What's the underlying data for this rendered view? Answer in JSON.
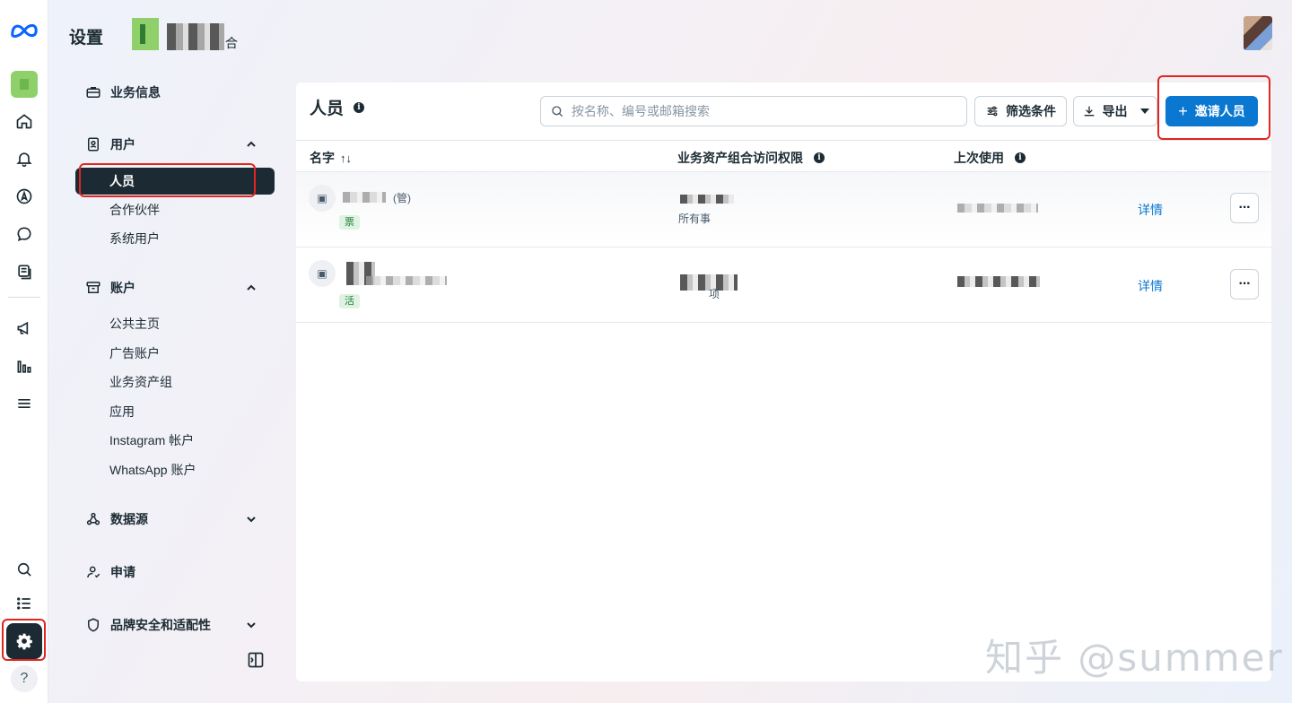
{
  "header": {
    "page_title": "设置",
    "business_name_suffix": "合"
  },
  "nav": {
    "business_info": "业务信息",
    "users": {
      "label": "用户",
      "items": [
        "人员",
        "合作伙伴",
        "系统用户"
      ],
      "active": "人员"
    },
    "accounts": {
      "label": "账户",
      "items": [
        "公共主页",
        "广告账户",
        "业务资产组",
        "应用",
        "Instagram 帐户",
        "WhatsApp 账户"
      ]
    },
    "data_sources": "数据源",
    "requests": "申请",
    "brand_safety": "品牌安全和适配性"
  },
  "panel": {
    "title": "人员",
    "search_placeholder": "按名称、编号或邮箱搜索",
    "filter_label": "筛选条件",
    "export_label": "导出",
    "invite_label": "邀请人员",
    "columns": {
      "name": "名字",
      "sort_glyph": "↑↓",
      "asset_access": "业务资产组合访问权限",
      "last_used": "上次使用"
    },
    "rows": [
      {
        "name_suffix": "(管)",
        "badge": "票",
        "access_text": "所有事",
        "details": "详情",
        "more": "···"
      },
      {
        "name_suffix": "",
        "badge": "活",
        "access_text": "项",
        "details": "详情",
        "more": "···"
      }
    ]
  },
  "rail": {
    "help_glyph": "?"
  },
  "watermark": "知乎 @summer",
  "colors": {
    "accent": "#0a78d1",
    "nav_active_bg": "#1c2b33",
    "highlight_box": "#e0261f",
    "meta_blue": "#0866ff"
  }
}
